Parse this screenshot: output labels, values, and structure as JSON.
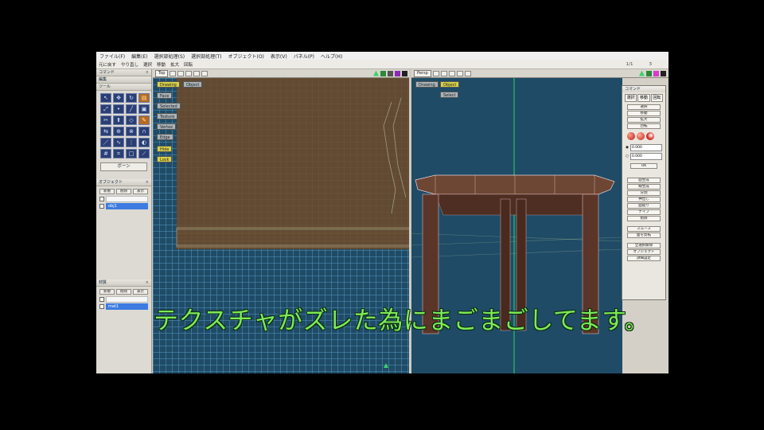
{
  "menubar": {
    "items": [
      "ファイル(F)",
      "編集(E)",
      "選択部処理(S)",
      "選択部処理(T)",
      "オブジェクト(O)",
      "表示(V)",
      "パネル(P)",
      "ヘルプ(H)"
    ]
  },
  "toolbar": {
    "items": [
      "元に戻す",
      "やり直し",
      "選択",
      "移動",
      "拡大",
      "回転"
    ],
    "right_a": "1/1",
    "right_b": "3"
  },
  "left_panel": {
    "section1": "コマンド",
    "section2": "編集",
    "section3": "ツール",
    "bone_button": "ボーン",
    "object_panel": {
      "title": "オブジェクト",
      "buttons": [
        "新規",
        "削除",
        "表示"
      ],
      "rows": [
        "obj1"
      ]
    },
    "material_panel": {
      "title": "材質",
      "buttons": [
        "新規",
        "削除",
        "表示"
      ],
      "rows": [
        "mat1"
      ]
    }
  },
  "viewport_left": {
    "label": "Top",
    "tags": [
      "Drawing",
      "Object",
      "Face",
      "Selected",
      "Texture",
      "Vertex",
      "Edge",
      "Hide",
      "Lock"
    ]
  },
  "viewport_right": {
    "label": "Persp",
    "tags": [
      "Drawing",
      "Object",
      "Select"
    ]
  },
  "dialog": {
    "title": "コマンド",
    "tabs": [
      "選択",
      "移動",
      "回転"
    ],
    "buttons_top": [
      "選択",
      "移動",
      "拡大",
      "回転"
    ],
    "spin1": "0.000",
    "spin2": "0.000",
    "ok": "OK",
    "buttons_mid": [
      "面生成",
      "線生成",
      "分割",
      "押出し",
      "面貼り",
      "ナイフ",
      "削除"
    ],
    "buttons_bottom": [
      "スムース",
      "面を反転",
      "全選択解除",
      "オブジェクト",
      "詳細設定"
    ]
  },
  "subtitle": "テクスチャがズレた為にまごまごしてます。",
  "colors": {
    "viewport_bg": "#1f4b66",
    "wood_texture": "#6b4a2a",
    "subtitle": "#7dea57",
    "nav_triangle": "#3bd16a"
  }
}
